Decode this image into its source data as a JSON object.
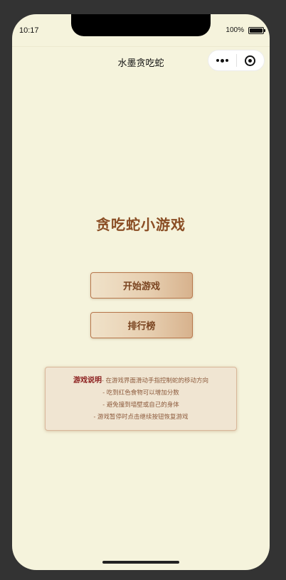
{
  "status_bar": {
    "time": "10:17",
    "battery_percent": "100%",
    "battery_level": 1.0
  },
  "navbar": {
    "title": "水墨贪吃蛇",
    "more_icon": "more-dots-icon",
    "close_icon": "target-icon"
  },
  "game": {
    "title": "贪吃蛇小游戏",
    "start_button": "开始游戏",
    "rank_button": "排行榜"
  },
  "help": {
    "title": "游戏说明",
    "lines": [
      "- 在游戏界面滑动手指控制蛇的移动方向",
      "- 吃到红色食物可以增加分数",
      "- 避免撞到墙壁或自己的身体",
      "- 游戏暂停时点击继续按钮恢复游戏"
    ]
  },
  "colors": {
    "background": "#f5f3dc",
    "title": "#8a4d24",
    "button_border": "#b7764b",
    "help_title": "#8b1d1d"
  }
}
